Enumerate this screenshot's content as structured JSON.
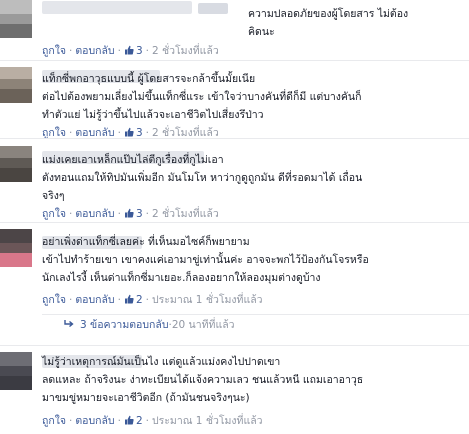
{
  "actions": {
    "like": "ถูกใจ",
    "reply": "ตอบกลับ",
    "separator": "·"
  },
  "colors": {
    "link": "#3b5998",
    "meta": "#9197a3",
    "text": "#141823",
    "divider": "#e9eaed"
  },
  "icons": {
    "like": "thumbs-up-icon",
    "reply": "reply-arrow-icon"
  },
  "comments": [
    {
      "text": "ความปลอดภัยของผู้โดยสาร ไม่ต้อง\nคิดนะ",
      "likes": "3",
      "time": "2 ชั่วโมงที่แล้ว"
    },
    {
      "text": "แท็กซี่พกอาวุธแบบนี้ ผู้โดยสารจะกล้าขึ้นมั้ยเนีย\nต่อไปต้องพยามเลี่ยงไม่ขึ้นแท็กซี่แระ เข้าใจว่าบางคันที่ดีก็มี แต่บางคันก็\nทำตัวแย่ ไม่รู้ว่าขึ้นไปแล้วจะเอาชีวิตไปเสี่ยงรึป่าว",
      "likes": "3",
      "time": "2 ชั่วโมงที่แล้ว"
    },
    {
      "text": "แม่งเคยเอาเหล็กแป๊บไล่ตีกูเรื่องที่กูไม่เอา\nตังทอนแถมให้ทิปมันเพิ่มอีก มันโมโห หาว่ากูดูถูกมัน ดีที่รอดมาได้ เถื่อน\nจริงๆ",
      "likes": "3",
      "time": "2 ชั่วโมงที่แล้ว"
    },
    {
      "text": "อย่าเพิ่งด่าแท็กซี่เลยค่ะ ที่เห็นมอไซค์ก็พยายาม\nเข้าไปทำร้ายเขา เขาคงแค่เอามาขู่เท่านั้นค่ะ อาจจะพกไว้ป้องกันโจรหรือ\nนักเลงไรงี้ เห็นด่าแท็กซี่มาเยอะ.ก็ลองอยากให้ลองมุมต่างดูบ้าง",
      "likes": "2",
      "time": "ประมาณ 1 ชั่วโมงที่แล้ว"
    },
    {
      "text": "ไม่รู้ว่าเหตุการณ์มันเป็นไง แต่ดูแล้วแม่งคงไปปาดเขา\nลดแหละ ถ้าจริงนะ ง่าทะเบียนได้แจ้งความเลว ชนแล้วหนี แถมเอาอาวุธ\nมาขมขู่หมายจะเอาชีวิตอีก (ถ้ามันชนจริงๆนะ)",
      "likes": "2",
      "time": "ประมาณ 1 ชั่วโมงที่แล้ว"
    }
  ],
  "replies": {
    "count_label": "3 ข้อความตอบกลับ",
    "time": "20 นาทีที่แล้ว"
  }
}
